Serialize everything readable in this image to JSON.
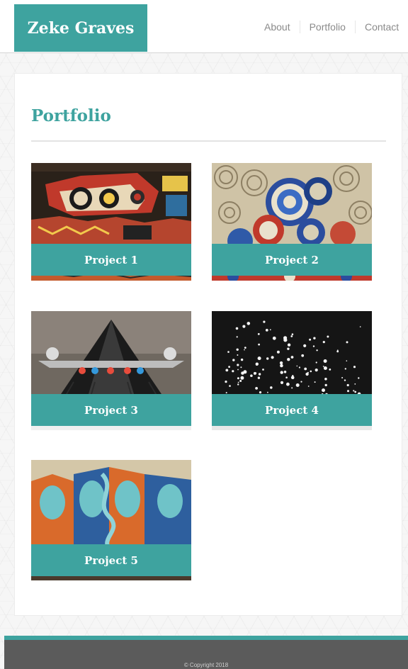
{
  "site": {
    "name": "Zeke Graves"
  },
  "nav": {
    "items": [
      {
        "label": "About"
      },
      {
        "label": "Portfolio"
      },
      {
        "label": "Contact"
      }
    ]
  },
  "main": {
    "title": "Portfolio",
    "projects": [
      {
        "label": "Project 1"
      },
      {
        "label": "Project 2"
      },
      {
        "label": "Project 3"
      },
      {
        "label": "Project 4"
      },
      {
        "label": "Project 5"
      }
    ]
  },
  "footer": {
    "copyright": "© Copyright 2018"
  },
  "colors": {
    "accent": "#3ea39f",
    "footer": "#5b5b5b",
    "nav_text": "#8a8a8a"
  },
  "icons": [
    "project-1-image",
    "project-2-image",
    "project-3-image",
    "project-4-image",
    "project-5-image"
  ]
}
